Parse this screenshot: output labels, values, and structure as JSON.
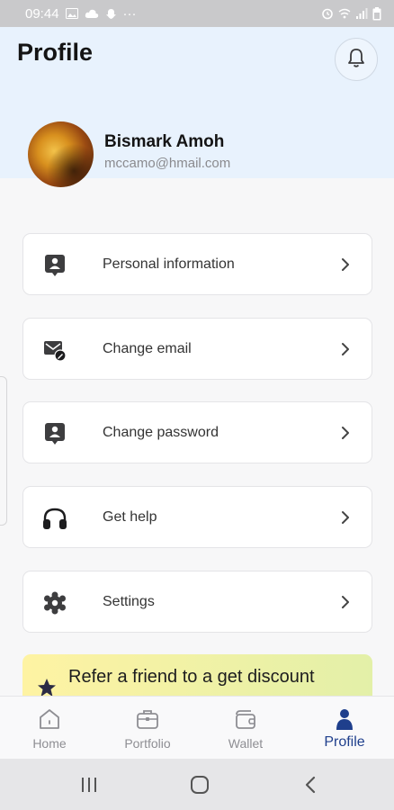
{
  "status_bar": {
    "time": "09:44",
    "overflow": "···"
  },
  "header": {
    "title": "Profile"
  },
  "profile": {
    "name": "Bismark Amoh",
    "email": "mccamo@hmail.com"
  },
  "menu": [
    {
      "label": "Personal information",
      "icon": "user-card-icon"
    },
    {
      "label": "Change email",
      "icon": "email-edit-icon"
    },
    {
      "label": "Change password",
      "icon": "password-icon"
    },
    {
      "label": "Get help",
      "icon": "headphones-icon"
    },
    {
      "label": "Settings",
      "icon": "gear-icon"
    }
  ],
  "banner": {
    "text": "Refer a friend to a get discount"
  },
  "nav": [
    {
      "label": "Home",
      "icon": "home-icon"
    },
    {
      "label": "Portfolio",
      "icon": "briefcase-icon"
    },
    {
      "label": "Wallet",
      "icon": "wallet-icon"
    },
    {
      "label": "Profile",
      "icon": "person-icon",
      "active": true
    }
  ],
  "colors": {
    "accent": "#1f3f8c",
    "header_bg": "#e8f2fd",
    "banner_start": "#fef3a3",
    "banner_end": "#e3f0a8"
  }
}
